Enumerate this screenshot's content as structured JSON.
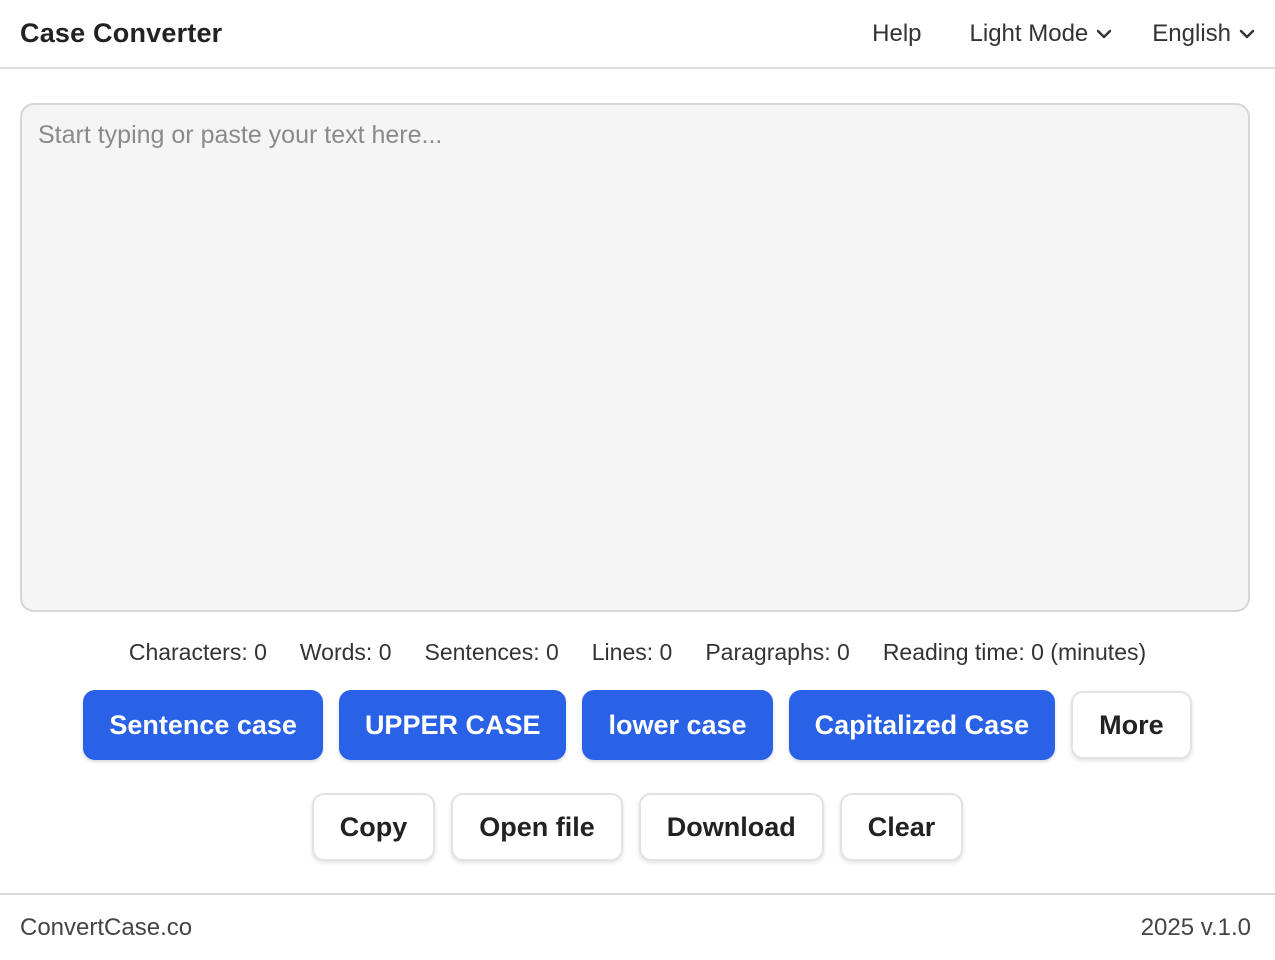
{
  "header": {
    "title": "Case Converter",
    "nav": {
      "help": "Help",
      "theme": "Light Mode",
      "language": "English"
    }
  },
  "editor": {
    "placeholder": "Start typing or paste your text here...",
    "value": ""
  },
  "stats": {
    "characters": "Characters: 0",
    "words": "Words: 0",
    "sentences": "Sentences: 0",
    "lines": "Lines: 0",
    "paragraphs": "Paragraphs: 0",
    "reading_time": "Reading time: 0 (minutes)"
  },
  "case_buttons": {
    "sentence": "Sentence case",
    "upper": "UPPER CASE",
    "lower": "lower case",
    "capitalized": "Capitalized Case",
    "more": "More"
  },
  "action_buttons": {
    "copy": "Copy",
    "open_file": "Open file",
    "download": "Download",
    "clear": "Clear"
  },
  "footer": {
    "brand": "ConvertCase.co",
    "version": "2025 v.1.0"
  },
  "colors": {
    "primary": "#2962e6",
    "editor_bg": "#f5f5f5"
  },
  "icons": {
    "dropdown": "chevron-down-icon"
  }
}
